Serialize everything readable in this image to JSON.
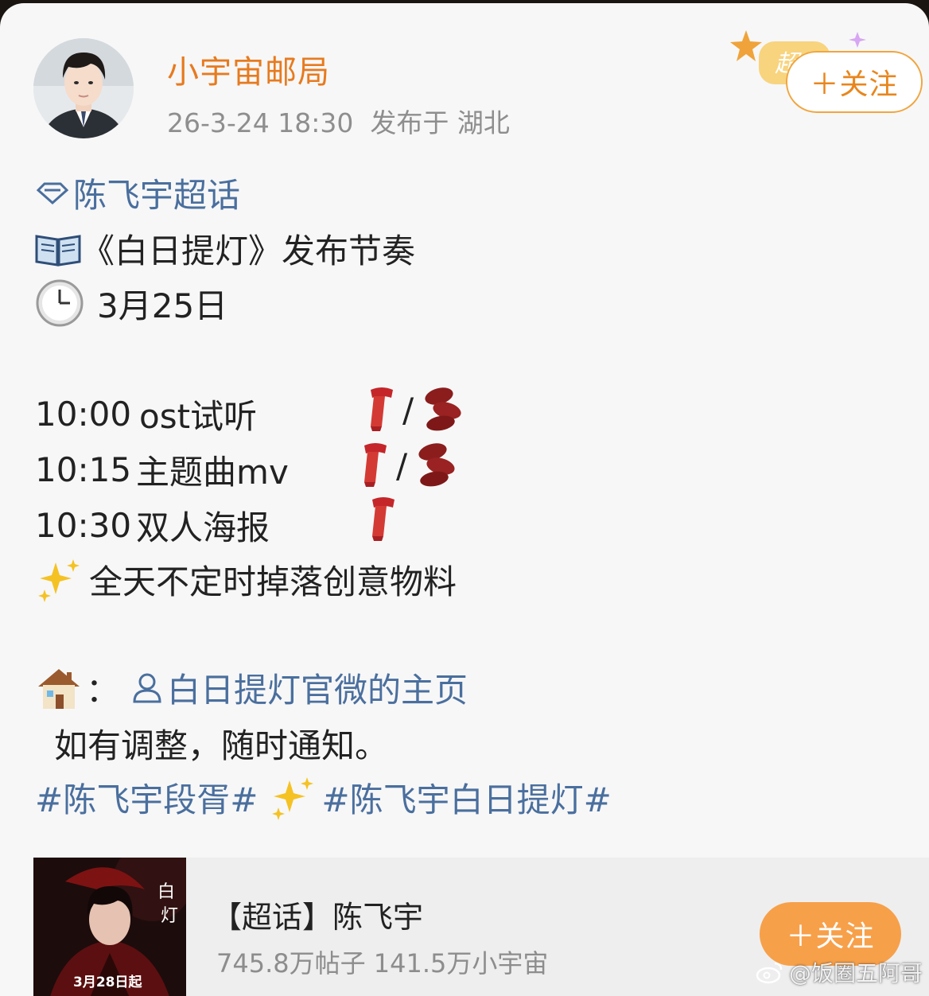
{
  "post": {
    "username": "小宇宙邮局",
    "date": "26-3-24 18:30",
    "location": "发布于 湖北",
    "follow_label": "＋关注",
    "super_badge_text": "超"
  },
  "content": {
    "supertopic": "陈飞宇超话",
    "title": "《白日提灯》发布节奏",
    "date": "3月25日",
    "schedule": [
      {
        "time": "10:00",
        "event": "ost试听",
        "slash": "/"
      },
      {
        "time": "10:15",
        "event": "主题曲mv",
        "slash": "/"
      },
      {
        "time": "10:30",
        "event": "双人海报",
        "slash": ""
      }
    ],
    "sparkle_line": "全天不定时掉落创意物料",
    "home_colon": "：",
    "home_link": "白日提灯官微的主页",
    "notice": "如有调整，随时通知。",
    "hashtag_1": "#陈飞宇段胥#",
    "hashtag_2": "#陈飞宇白日提灯#"
  },
  "topic_card": {
    "title": "【超话】陈飞宇",
    "stats": "745.8万帖子 141.5万小宇宙",
    "follow_label": "＋关注",
    "poster_date": "3月28日起"
  },
  "watermark": "@饭圈五阿哥",
  "icons": [
    "diamond-icon",
    "book-icon",
    "clock-icon",
    "scarf-icon",
    "beans-icon",
    "sparkles-icon",
    "house-icon",
    "user-icon",
    "weibo-icon"
  ],
  "colors": {
    "accent": "#e77a1f",
    "link": "#4a6f9e",
    "follow_fill": "#f7a04a"
  }
}
